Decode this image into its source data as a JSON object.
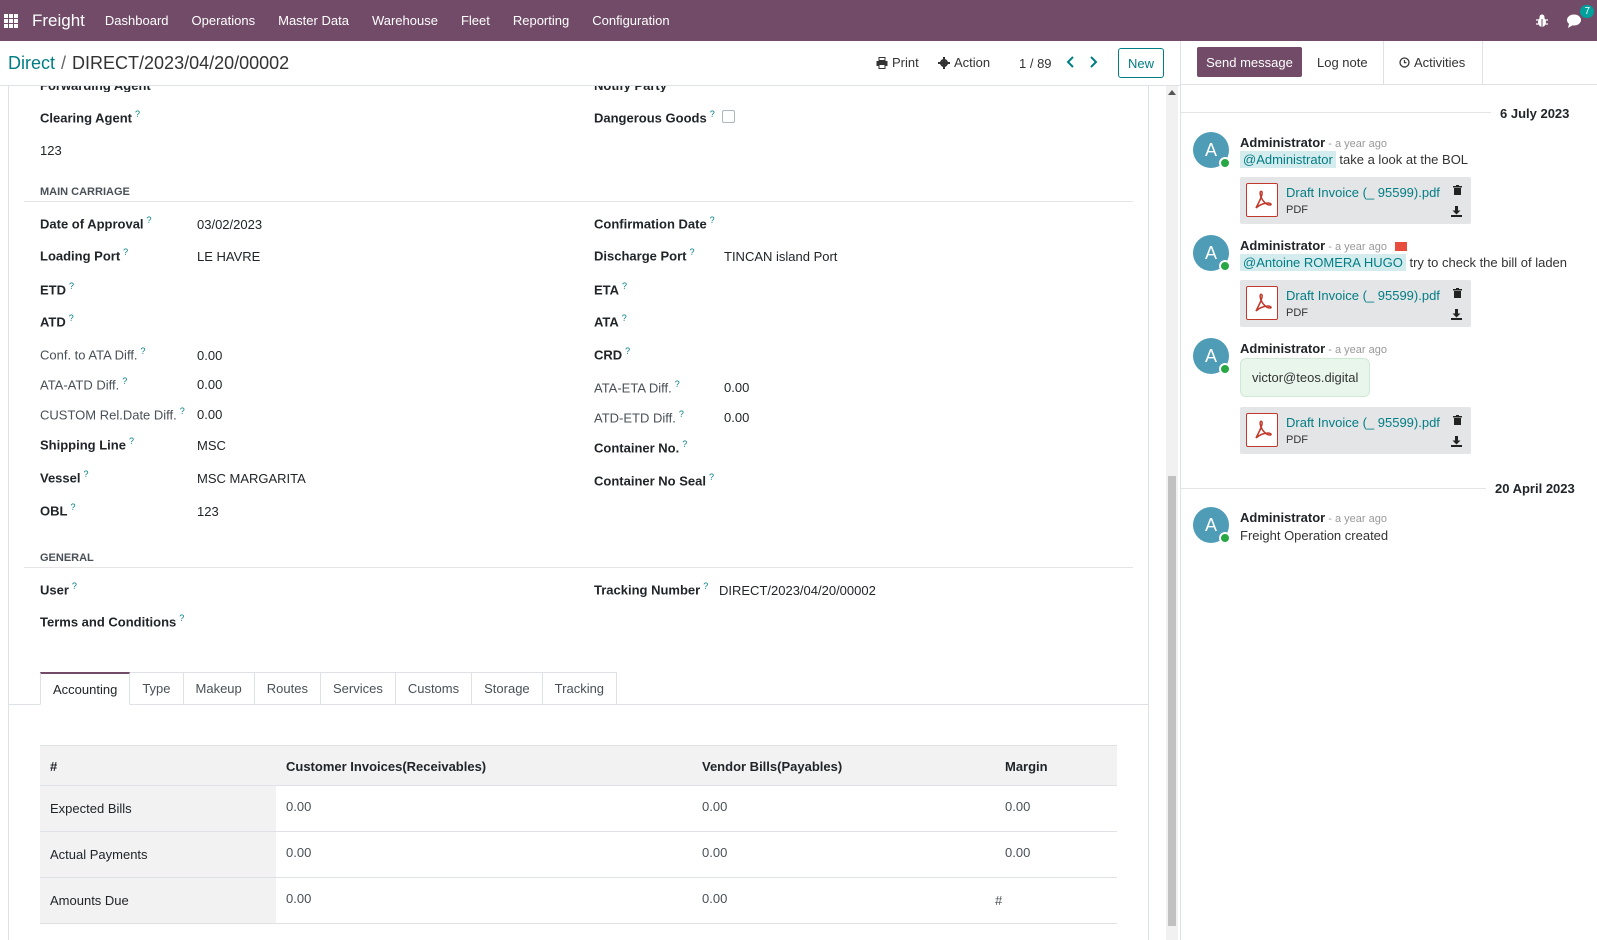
{
  "topbar": {
    "brand": "Freight",
    "menu": [
      "Dashboard",
      "Operations",
      "Master Data",
      "Warehouse",
      "Fleet",
      "Reporting",
      "Configuration"
    ],
    "chat_count": "7"
  },
  "control": {
    "breadcrumb_parent": "Direct",
    "breadcrumb_separator": "/",
    "breadcrumb_current": "DIRECT/2023/04/20/00002",
    "print_label": "Print",
    "action_label": "Action",
    "pager": "1 / 89",
    "new_label": "New"
  },
  "form": {
    "top_cut_left": "Forwarding Agent",
    "top_cut_right": "Notify Party",
    "clearing_agent_label": "Clearing Agent",
    "clearing_agent_value": "123",
    "dangerous_goods_label": "Dangerous Goods",
    "dangerous_goods_checked": false,
    "main_carriage_title": "MAIN CARRIAGE",
    "date_of_approval_label": "Date of Approval",
    "date_of_approval_value": "03/02/2023",
    "confirmation_date_label": "Confirmation Date",
    "loading_port_label": "Loading Port",
    "loading_port_value": "LE HAVRE",
    "discharge_port_label": "Discharge Port",
    "discharge_port_value": "TINCAN island Port",
    "etd_label": "ETD",
    "eta_label": "ETA",
    "atd_label": "ATD",
    "ata_label": "ATA",
    "conf_ata_label": "Conf. to ATA Diff.",
    "conf_ata_value": "0.00",
    "crd_label": "CRD",
    "ata_atd_label": "ATA-ATD Diff.",
    "ata_atd_value": "0.00",
    "ata_eta_label": "ATA-ETA Diff.",
    "ata_eta_value": "0.00",
    "custom_rel_label": "CUSTOM Rel.Date Diff.",
    "custom_rel_value": "0.00",
    "atd_etd_label": "ATD-ETD Diff.",
    "atd_etd_value": "0.00",
    "shipping_line_label": "Shipping Line",
    "shipping_line_value": "MSC",
    "container_no_label": "Container No.",
    "vessel_label": "Vessel",
    "vessel_value": "MSC MARGARITA",
    "container_seal_label": "Container No Seal",
    "obl_label": "OBL",
    "obl_value": "123",
    "general_title": "GENERAL",
    "user_label": "User",
    "tracking_label": "Tracking Number",
    "tracking_value": "DIRECT/2023/04/20/00002",
    "terms_label": "Terms and Conditions",
    "help_mark": "?"
  },
  "tabs": [
    "Accounting",
    "Type",
    "Makeup",
    "Routes",
    "Services",
    "Customs",
    "Storage",
    "Tracking"
  ],
  "accounting": {
    "headers": [
      "#",
      "Customer Invoices(Receivables)",
      "Vendor Bills(Payables)",
      "Margin"
    ],
    "rows": [
      {
        "label": "Expected Bills",
        "receivables": "0.00",
        "payables": "0.00",
        "margin": "0.00"
      },
      {
        "label": "Actual Payments",
        "receivables": "0.00",
        "payables": "0.00",
        "margin": "0.00"
      },
      {
        "label": "Amounts Due",
        "receivables": "0.00",
        "payables": "0.00",
        "margin": "#"
      }
    ]
  },
  "chatter": {
    "send_message": "Send message",
    "log_note": "Log note",
    "activities": "Activities",
    "date1": "6 July 2023",
    "date2": "20 April 2023",
    "messages": [
      {
        "avatar": "A",
        "author": "Administrator",
        "ago": "- a year ago",
        "mention": "@Administrator",
        "text": "take a look at the BOL",
        "attachment": "Draft Invoice (_ 95599).pdf",
        "type": "PDF"
      },
      {
        "avatar": "A",
        "author": "Administrator",
        "ago": "- a year ago",
        "mention": "@Antoine ROMERA HUGO",
        "text": "try to check the bill of laden",
        "attachment": "Draft Invoice (_ 95599).pdf",
        "type": "PDF"
      },
      {
        "avatar": "A",
        "author": "Administrator",
        "ago": "- a year ago",
        "bubble": "victor@teos.digital",
        "attachment": "Draft Invoice (_ 95599).pdf",
        "type": "PDF"
      },
      {
        "avatar": "A",
        "author": "Administrator",
        "ago": "- a year ago",
        "text": "Freight Operation created"
      }
    ]
  },
  "colors": {
    "brand": "#714b67",
    "link": "#017e84",
    "online": "#28a745"
  }
}
